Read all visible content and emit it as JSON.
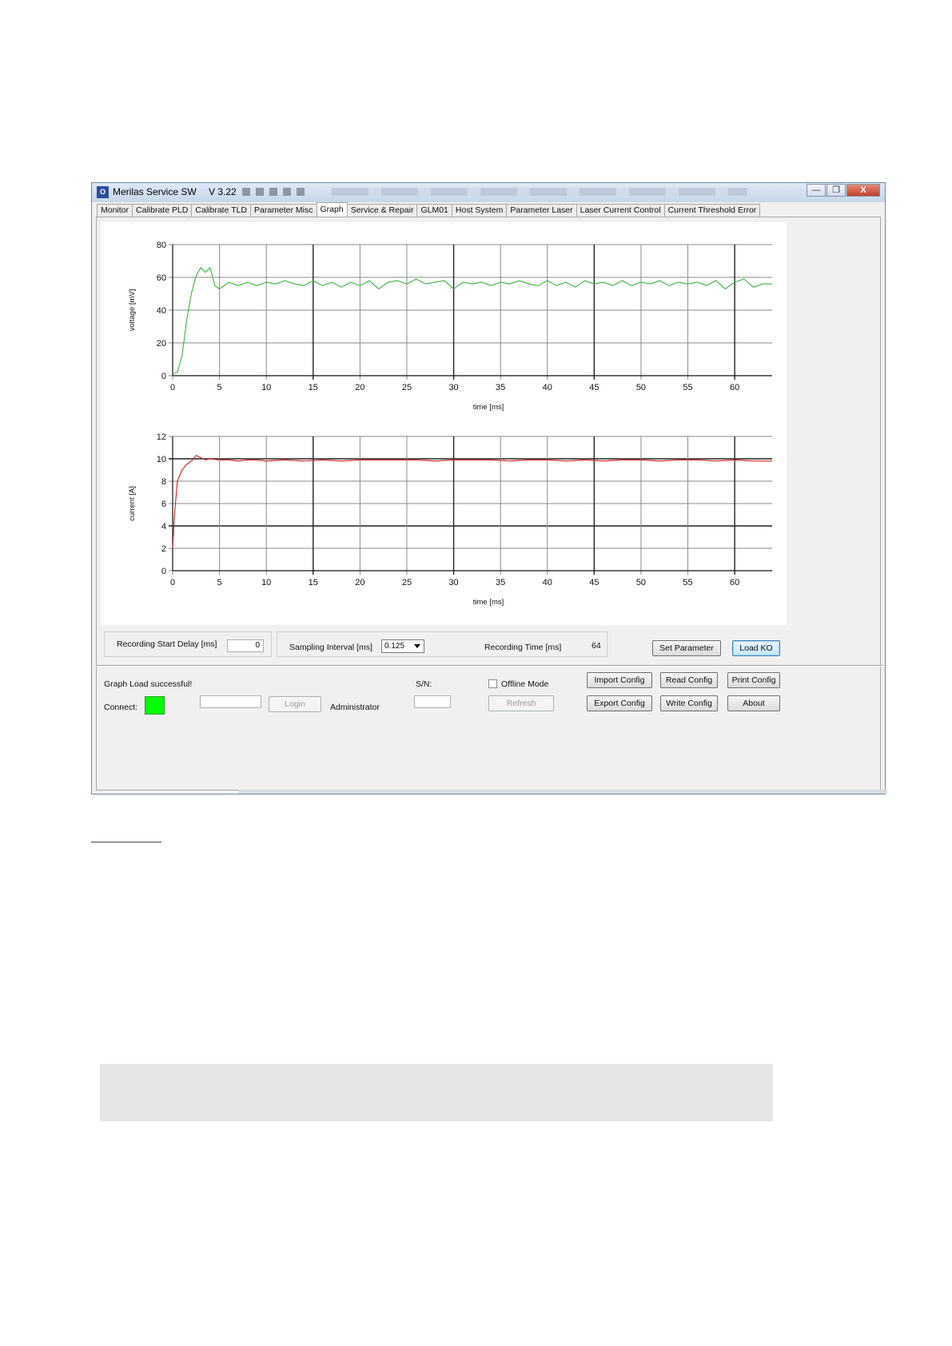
{
  "window": {
    "title": "Merilas Service SW",
    "version": "V 3.22",
    "minimize_glyph": "—",
    "maximize_glyph": "❐",
    "close_glyph": "X"
  },
  "tabs": [
    {
      "label": "Monitor"
    },
    {
      "label": "Calibrate PLD"
    },
    {
      "label": "Calibrate TLD"
    },
    {
      "label": "Parameter Misc"
    },
    {
      "label": "Graph"
    },
    {
      "label": "Service & Repair"
    },
    {
      "label": "GLM01"
    },
    {
      "label": "Host System"
    },
    {
      "label": "Parameter Laser"
    },
    {
      "label": "Laser Current Control"
    },
    {
      "label": "Current Threshold Error"
    }
  ],
  "chart_data": [
    {
      "type": "line",
      "xlabel": "time [ms]",
      "ylabel": "voltage [mV]",
      "xlim": [
        0,
        64
      ],
      "ylim": [
        0,
        80
      ],
      "xticks": [
        0,
        5,
        10,
        15,
        20,
        25,
        30,
        35,
        40,
        45,
        50,
        55,
        60
      ],
      "yticks": [
        0,
        20,
        40,
        60,
        80
      ],
      "color": "#3cb43c",
      "series": [
        {
          "x": [
            0,
            0.5,
            1,
            1.5,
            2,
            2.5,
            3,
            3.5,
            4,
            4.5,
            5,
            6,
            7,
            8,
            9,
            10,
            11,
            12,
            13,
            14,
            15,
            16,
            17,
            18,
            19,
            20,
            21,
            22,
            23,
            24,
            25,
            26,
            27,
            28,
            29,
            30,
            31,
            32,
            33,
            34,
            35,
            36,
            37,
            38,
            39,
            40,
            41,
            42,
            43,
            44,
            45,
            46,
            47,
            48,
            49,
            50,
            51,
            52,
            53,
            54,
            55,
            56,
            57,
            58,
            59,
            60,
            61,
            62,
            63,
            64
          ],
          "y": [
            1,
            2,
            12,
            34,
            50,
            61,
            66,
            63,
            66,
            55,
            53,
            57,
            55,
            57,
            55,
            57,
            56,
            58,
            56,
            55,
            58,
            55,
            57,
            54,
            57,
            55,
            58,
            53,
            57,
            58,
            56,
            59,
            56,
            57,
            58,
            53,
            57,
            56,
            57,
            55,
            57,
            56,
            58,
            56,
            55,
            58,
            55,
            57,
            54,
            58,
            56,
            57,
            55,
            58,
            55,
            57,
            56,
            58,
            55,
            57,
            56,
            57,
            55,
            58,
            53,
            57,
            59,
            54,
            56,
            56
          ]
        }
      ]
    },
    {
      "type": "line",
      "xlabel": "time [ms]",
      "ylabel": "current [A]",
      "xlim": [
        0,
        64
      ],
      "ylim": [
        0,
        12
      ],
      "xticks": [
        0,
        5,
        10,
        15,
        20,
        25,
        30,
        35,
        40,
        45,
        50,
        55,
        60
      ],
      "yticks": [
        0,
        2,
        4,
        6,
        8,
        10,
        12
      ],
      "color": "#d42020",
      "series": [
        {
          "x": [
            0,
            0.2,
            0.5,
            1,
            1.5,
            2,
            2.5,
            3,
            3.5,
            4,
            5,
            6,
            7,
            8,
            9,
            10,
            12,
            14,
            16,
            18,
            20,
            22,
            24,
            26,
            28,
            30,
            32,
            34,
            36,
            38,
            40,
            42,
            44,
            46,
            48,
            50,
            52,
            54,
            56,
            58,
            60,
            62,
            64
          ],
          "y": [
            2,
            5,
            8,
            9,
            9.5,
            9.8,
            10.3,
            10.1,
            9.9,
            10,
            9.9,
            9.9,
            9.8,
            9.9,
            9.9,
            9.8,
            9.9,
            9.8,
            9.9,
            9.8,
            9.9,
            9.9,
            9.9,
            9.9,
            9.8,
            9.9,
            9.9,
            9.9,
            9.8,
            9.9,
            9.9,
            9.8,
            9.9,
            9.8,
            9.9,
            9.9,
            9.8,
            9.9,
            9.9,
            9.8,
            9.9,
            9.8,
            9.8
          ]
        }
      ]
    }
  ],
  "controls": {
    "recording_start_delay_label": "Recording Start Delay [ms]",
    "recording_start_delay_value": "0",
    "sampling_interval_label": "Sampling Interval [ms]",
    "sampling_interval_value": "0.125",
    "recording_time_label": "Recording Time [ms]",
    "recording_time_value": "64",
    "set_parameter": "Set Parameter",
    "load_ko": "Load KO"
  },
  "status": {
    "message": "Graph Load successful!",
    "connect_label": "Connect:",
    "connect_color": "#00ff00",
    "login": "Login",
    "user": "Administrator",
    "sn_label": "S/N:",
    "offline_mode": "Offline Mode",
    "refresh": "Refresh",
    "import_config": "Import Config",
    "read_config": "Read Config",
    "print_config": "Print Config",
    "export_config": "Export Config",
    "write_config": "Write Config",
    "about": "About"
  }
}
